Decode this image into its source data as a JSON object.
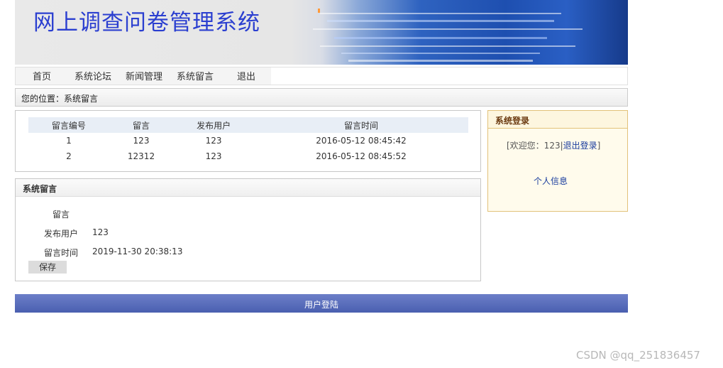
{
  "header": {
    "title": "网上调查问卷管理系统"
  },
  "nav": {
    "items": [
      {
        "label": "首页"
      },
      {
        "label": "系统论坛"
      },
      {
        "label": "新闻管理"
      },
      {
        "label": "系统留言"
      },
      {
        "label": "退出"
      }
    ]
  },
  "breadcrumb": {
    "text": "您的位置：系统留言"
  },
  "messages": {
    "columns": [
      "留言编号",
      "留言",
      "发布用户",
      "留言时间"
    ],
    "rows": [
      [
        "1",
        "123",
        "123",
        "2016-05-12 08:45:42"
      ],
      [
        "2",
        "12312",
        "123",
        "2016-05-12 08:45:52"
      ]
    ]
  },
  "form": {
    "title": "系统留言",
    "fields": [
      {
        "label": "留言",
        "value": ""
      },
      {
        "label": "发布用户",
        "value": "123"
      },
      {
        "label": "留言时间",
        "value": "2019-11-30 20:38:13"
      }
    ],
    "save_label": "保存"
  },
  "login": {
    "title": "系统登录",
    "welcome_prefix": "[欢迎您：123|",
    "logout_label": "退出登录",
    "welcome_suffix": "]",
    "profile_label": "个人信息"
  },
  "footer": {
    "label": "用户登陆"
  },
  "watermark": "CSDN @qq_251836457"
}
